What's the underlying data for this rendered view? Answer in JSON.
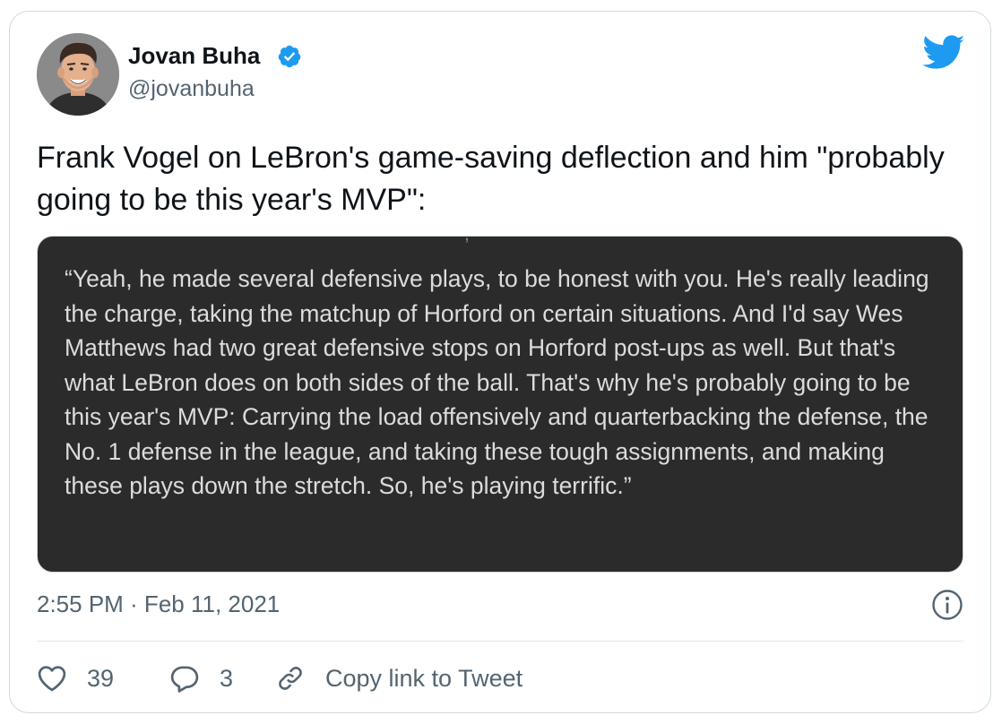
{
  "author": {
    "display_name": "Jovan Buha",
    "handle": "@jovanbuha",
    "verified": true,
    "avatar_icon": "avatar-illustration"
  },
  "brand": {
    "icon": "twitter-bird-icon",
    "color": "#1d9bf0"
  },
  "tweet": {
    "text": "Frank Vogel on LeBron's game-saving deflection and him \"probably going to be this year's MVP\":",
    "media": {
      "quote": "“Yeah, he made several defensive plays, to be honest with you. He's really leading the charge, taking the matchup of Horford on certain situations. And I'd say Wes Matthews had two great defensive stops on Horford post-ups as well. But that's what LeBron does on both sides of the ball. That's why he's probably going to be this year's MVP: Carrying the load offensively and quarterbacking the defense, the No. 1 defense in the league, and taking these tough assignments, and making these plays down the stretch. So, he's playing terrific.”",
      "background": "#2b2b2b"
    },
    "timestamp": "2:55 PM · Feb 11, 2021"
  },
  "actions": {
    "likes": "39",
    "replies": "3",
    "copy_link_label": "Copy link to Tweet"
  }
}
